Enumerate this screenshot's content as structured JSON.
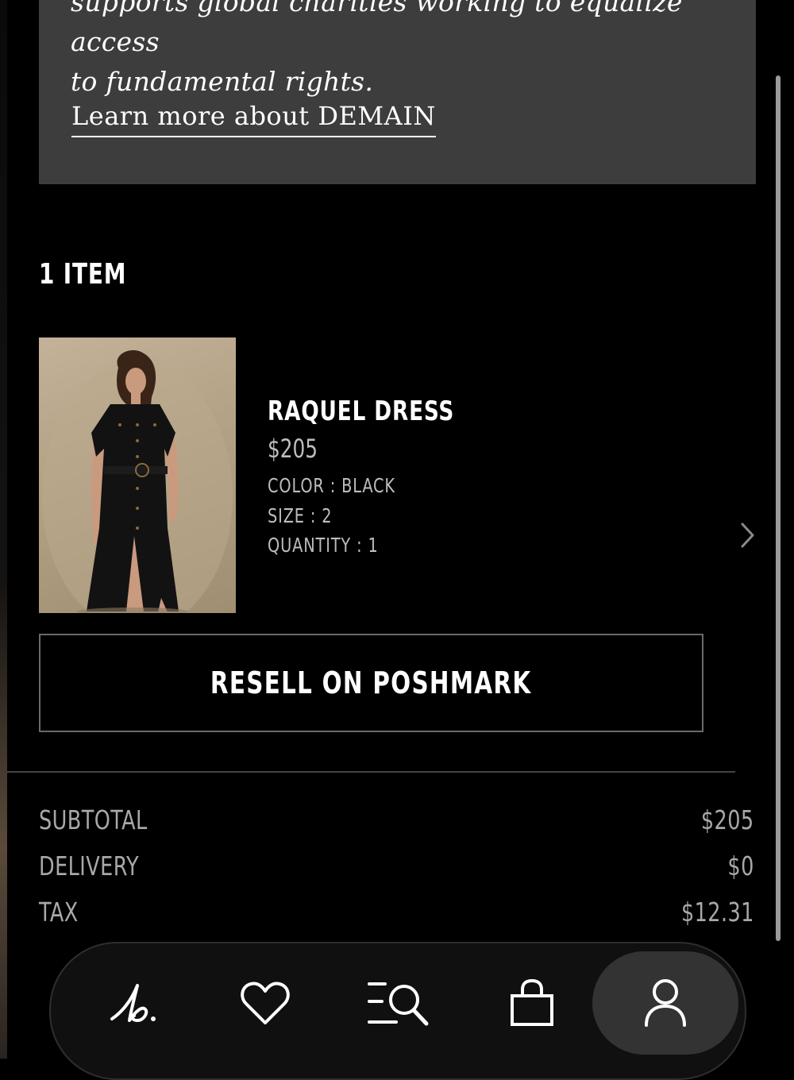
{
  "info_card": {
    "text_line1": "supports global charities working to equalize access",
    "text_line2": "to fundamental rights.",
    "learn_more_link": "Learn more about DEMAIN"
  },
  "items_section": {
    "heading": "1 ITEM"
  },
  "product": {
    "name": "RAQUEL DRESS",
    "price": "$205",
    "color": "COLOR : BLACK",
    "size": "SIZE : 2",
    "quantity": "QUANTITY : 1",
    "image_alt": "Woman wearing black belted button-front shirt dress"
  },
  "resell_button": {
    "label": "RESELL ON POSHMARK"
  },
  "summary": {
    "rows": [
      {
        "label": "SUBTOTAL",
        "value": "$205"
      },
      {
        "label": "DELIVERY",
        "value": "$0"
      },
      {
        "label": "TAX",
        "value": "$12.31"
      }
    ]
  },
  "bottom_nav": {
    "items": [
      {
        "icon": "brand-logo-icon",
        "active": false
      },
      {
        "icon": "heart-icon",
        "active": false
      },
      {
        "icon": "search-menu-icon",
        "active": false
      },
      {
        "icon": "shopping-bag-icon",
        "active": false
      },
      {
        "icon": "profile-icon",
        "active": true
      }
    ]
  },
  "colors": {
    "background": "#000000",
    "card": "#3d3d3d",
    "muted_text": "#bdbdbd",
    "nav_active": "#333333"
  }
}
